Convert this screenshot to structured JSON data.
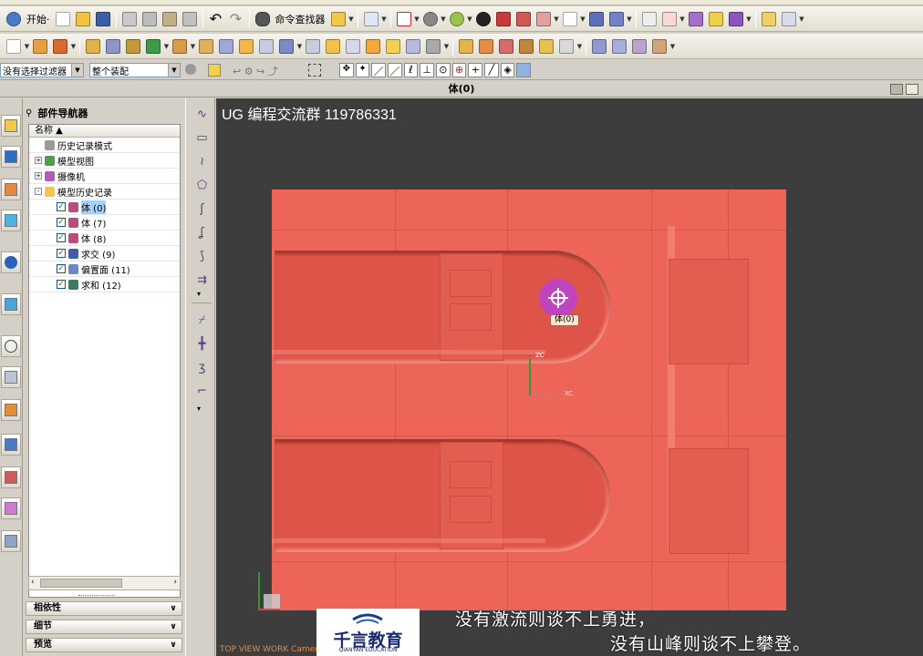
{
  "toolbar1": {
    "start_label": "开始·",
    "command_finder_label": "命令查找器"
  },
  "filter": {
    "selection_filter": "没有选择过滤器",
    "assembly_scope": "整个装配"
  },
  "window_title": "体(0)",
  "navigator": {
    "title": "部件导航器",
    "column_header": "名称 ▲",
    "items": [
      {
        "label": "历史记录模式",
        "level": 0,
        "icon": "clock-icon"
      },
      {
        "label": "模型视图",
        "level": 0,
        "expand": "+",
        "icon": "views-icon"
      },
      {
        "label": "摄像机",
        "level": 0,
        "expand": "+",
        "icon": "camera-icon"
      },
      {
        "label": "模型历史记录",
        "level": 0,
        "expand": "-",
        "icon": "folder-icon"
      },
      {
        "label": "体 (0)",
        "level": 1,
        "checked": true,
        "icon": "body-icon",
        "selected": true
      },
      {
        "label": "体 (7)",
        "level": 1,
        "checked": true,
        "icon": "body-icon"
      },
      {
        "label": "体 (8)",
        "level": 1,
        "checked": true,
        "icon": "body-icon"
      },
      {
        "label": "求交 (9)",
        "level": 1,
        "checked": true,
        "icon": "intersect-icon"
      },
      {
        "label": "偏置面 (11)",
        "level": 1,
        "checked": true,
        "icon": "offset-face-icon"
      },
      {
        "label": "求和 (12)",
        "level": 1,
        "checked": true,
        "icon": "unite-icon"
      }
    ],
    "panels": [
      "相依性",
      "细节",
      "预览"
    ]
  },
  "viewport": {
    "title": "UG 编程交流群 119786331",
    "tooltip": "体(0)",
    "status_text": "TOP VIEW WORK Camera",
    "axis_labels": {
      "z": "ZC",
      "x": "XC"
    },
    "logo_main": "千言教育",
    "logo_sub": "QIANYAN EDUCATION",
    "subtitle_line1": "没有激流则谈不上勇进，",
    "subtitle_line2": "没有山峰则谈不上攀登。"
  },
  "colors": {
    "part": "#ed6458",
    "viewport_bg": "#3d3d3d",
    "cursor": "#c044bd"
  }
}
